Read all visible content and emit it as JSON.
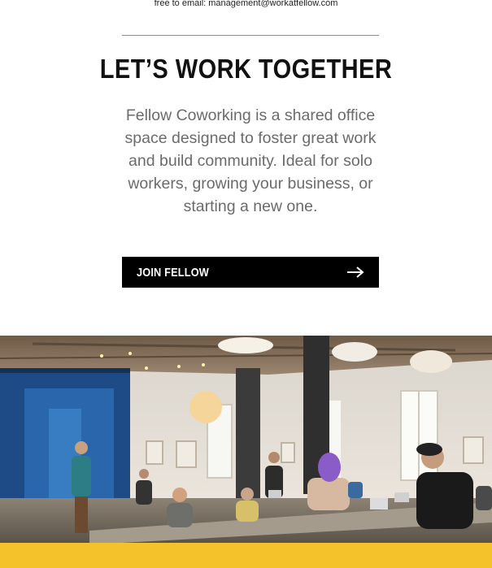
{
  "contact": {
    "email_line": "free to email: management@workatfellow.com"
  },
  "hero": {
    "title": "LET’S WORK TOGETHER",
    "description": "Fellow Coworking is a shared office space designed to foster great work and build community. Ideal for solo workers, growing your business, or starting a new one.",
    "cta_label": "JOIN FELLOW",
    "cta_icon": "arrow-right-icon"
  },
  "photo": {
    "subject": "coworking-space-photo"
  },
  "colors": {
    "accent_yellow": "#f4c22b",
    "cta_background": "#000000",
    "body_text": "#6b6b6b"
  }
}
